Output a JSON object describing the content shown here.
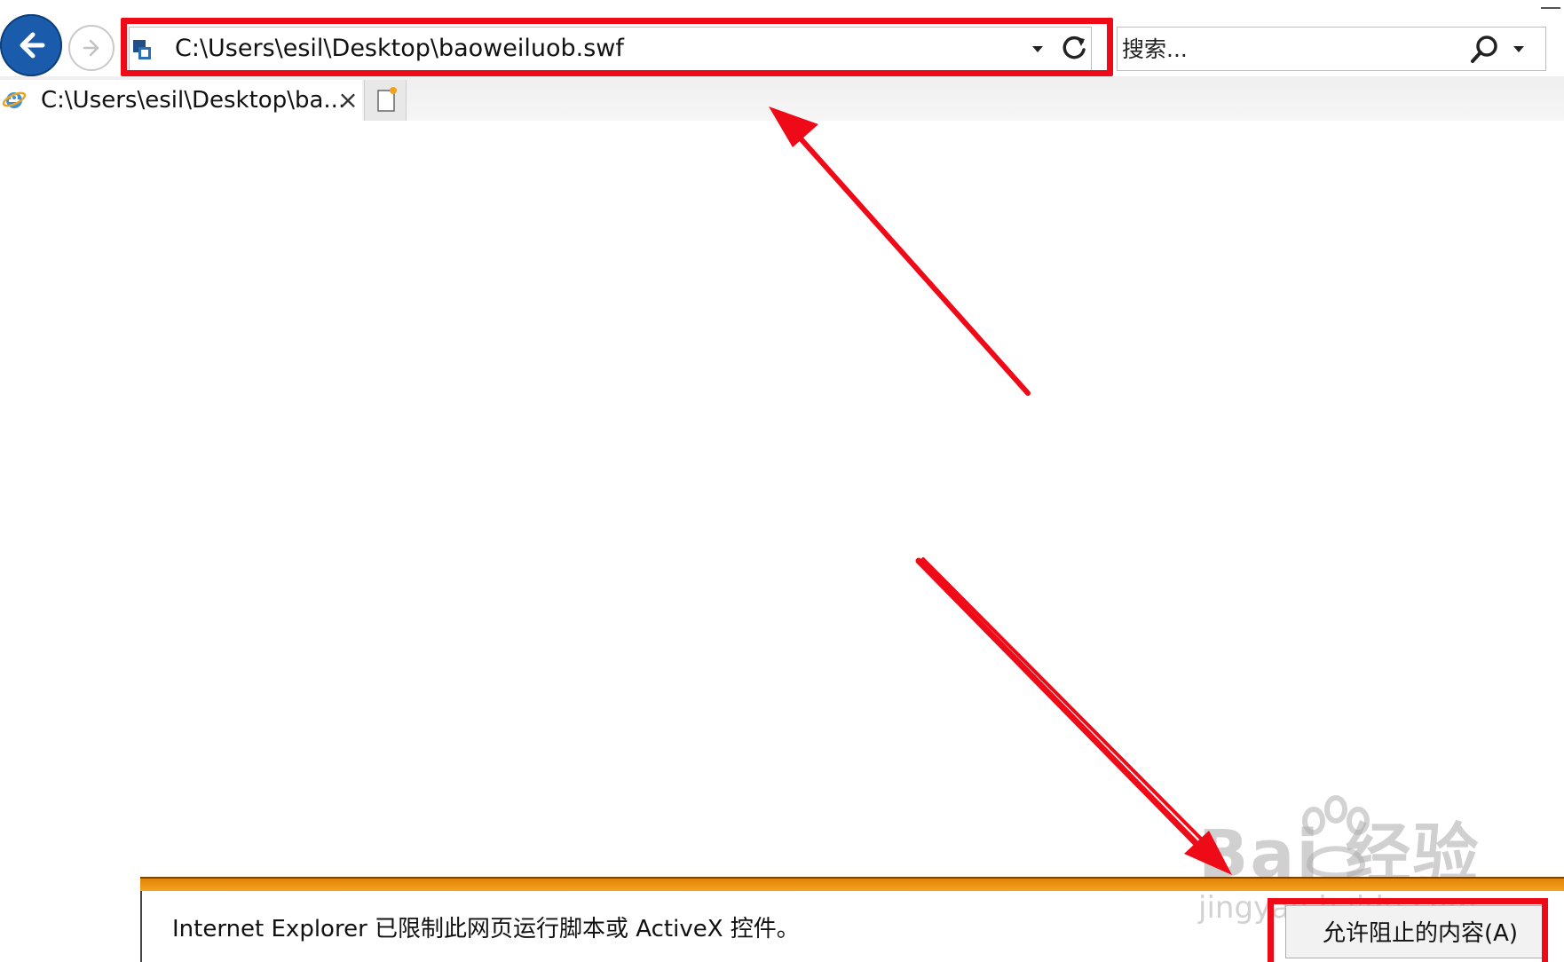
{
  "browser": {
    "address_bar": {
      "url": "C:\\Users\\esil\\Desktop\\baoweiluob.swf"
    },
    "search": {
      "placeholder": "搜索..."
    },
    "tabs": [
      {
        "label": "C:\\Users\\esil\\Desktop\\ba...",
        "close_glyph": "×",
        "active": true
      }
    ]
  },
  "notification": {
    "message": "Internet Explorer 已限制此网页运行脚本或 ActiveX 控件。",
    "allow_button_label": "允许阻止的内容(A)"
  },
  "watermark": {
    "brand": "Bai  经验",
    "site": "jingyan.baidu.com"
  },
  "icons": {
    "back": "back-arrow-icon",
    "forward": "forward-arrow-icon",
    "page": "page-icon",
    "dropdown": "chevron-down-icon",
    "refresh": "refresh-icon",
    "search": "search-icon",
    "favicon": "ie-logo-icon",
    "new_tab": "new-tab-icon"
  },
  "colors": {
    "annotation_red": "#ef0a18",
    "notification_orange": "#f19a1c",
    "back_button_blue": "#1a5cab"
  }
}
